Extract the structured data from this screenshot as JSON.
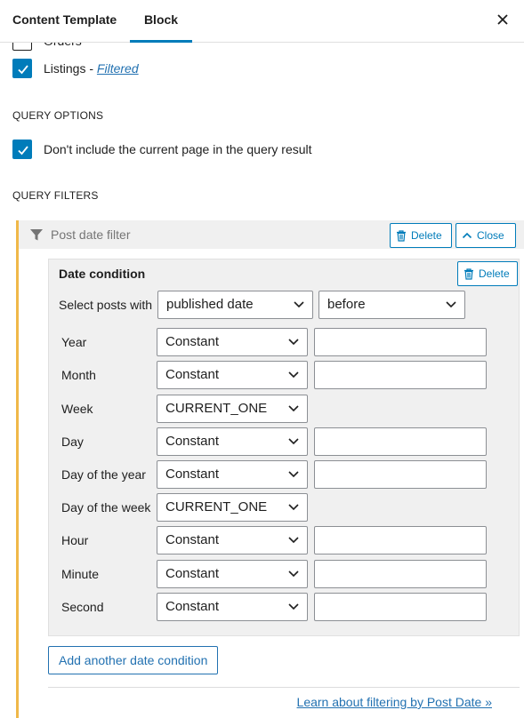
{
  "header": {
    "tab_content": "Content Template",
    "tab_block": "Block"
  },
  "post_types": {
    "orders_label": "Orders",
    "listings_label": "Listings",
    "listings_sep": " - ",
    "listings_link": "Filtered"
  },
  "query_options": {
    "title": "QUERY OPTIONS",
    "exclude_current_label": "Don't include the current page in the query result"
  },
  "query_filters": {
    "title": "QUERY FILTERS",
    "filter_title": "Post date filter",
    "delete_label": "Delete",
    "close_label": "Close",
    "condition": {
      "title": "Date condition",
      "delete_label": "Delete",
      "select_posts_label": "Select posts with",
      "date_field": "published date",
      "comparison": "before",
      "rows": [
        {
          "label": "Year",
          "source": "Constant",
          "value": ""
        },
        {
          "label": "Month",
          "source": "Constant",
          "value": ""
        },
        {
          "label": "Week",
          "source": "CURRENT_ONE"
        },
        {
          "label": "Day",
          "source": "Constant",
          "value": ""
        },
        {
          "label": "Day of the year",
          "source": "Constant",
          "value": ""
        },
        {
          "label": "Day of the week",
          "source": "CURRENT_ONE"
        },
        {
          "label": "Hour",
          "source": "Constant",
          "value": ""
        },
        {
          "label": "Minute",
          "source": "Constant",
          "value": ""
        },
        {
          "label": "Second",
          "source": "Constant",
          "value": ""
        }
      ]
    },
    "add_condition_label": "Add another date condition",
    "learn_link": "Learn about filtering by Post Date »"
  },
  "colors": {
    "accent": "#007cba",
    "filter_border": "#f0b849"
  },
  "icons": [
    "close-icon",
    "checkmark-icon",
    "funnel-icon",
    "trash-icon",
    "chevron-up-icon",
    "chevron-down-icon"
  ]
}
